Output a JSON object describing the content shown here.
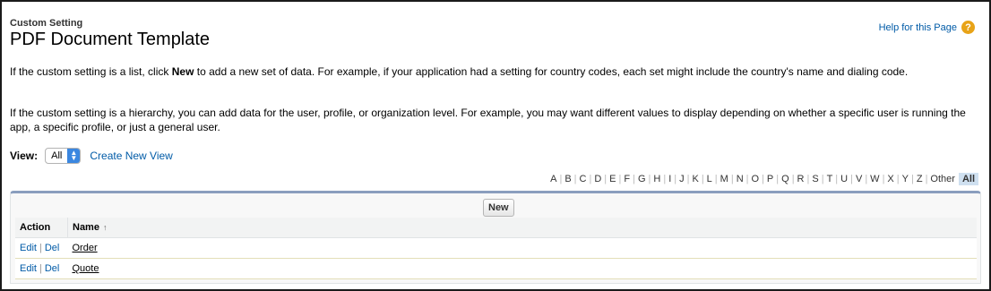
{
  "header": {
    "type_label": "Custom Setting",
    "title": "PDF Document Template"
  },
  "help": {
    "label": "Help for this Page",
    "icon": "question-icon"
  },
  "paragraphs": {
    "p1_before": "If the custom setting is a list, click ",
    "p1_bold": "New",
    "p1_after": " to add a new set of data. For example, if your application had a setting for country codes, each set might include the country's name and dialing code.",
    "p2": "If the custom setting is a hierarchy, you can add data for the user, profile, or organization level. For example, you may want different values to display depending on whether a specific user is running the app, a specific profile, or just a general user."
  },
  "view": {
    "label": "View:",
    "selected": "All",
    "create_link": "Create New View"
  },
  "alpha": {
    "letters": [
      "A",
      "B",
      "C",
      "D",
      "E",
      "F",
      "G",
      "H",
      "I",
      "J",
      "K",
      "L",
      "M",
      "N",
      "O",
      "P",
      "Q",
      "R",
      "S",
      "T",
      "U",
      "V",
      "W",
      "X",
      "Y",
      "Z"
    ],
    "other": "Other",
    "all": "All"
  },
  "list": {
    "new_label": "New",
    "columns": {
      "action": "Action",
      "name": "Name",
      "sort_icon": "sort-ascending-icon"
    },
    "rows": [
      {
        "edit": "Edit",
        "del": "Del",
        "name": "Order"
      },
      {
        "edit": "Edit",
        "del": "Del",
        "name": "Quote"
      }
    ]
  },
  "colors": {
    "link": "#015ba7",
    "help_icon": "#e8a317",
    "all_highlight": "#cfe0f0",
    "panel_top": "#8a9ebe"
  }
}
